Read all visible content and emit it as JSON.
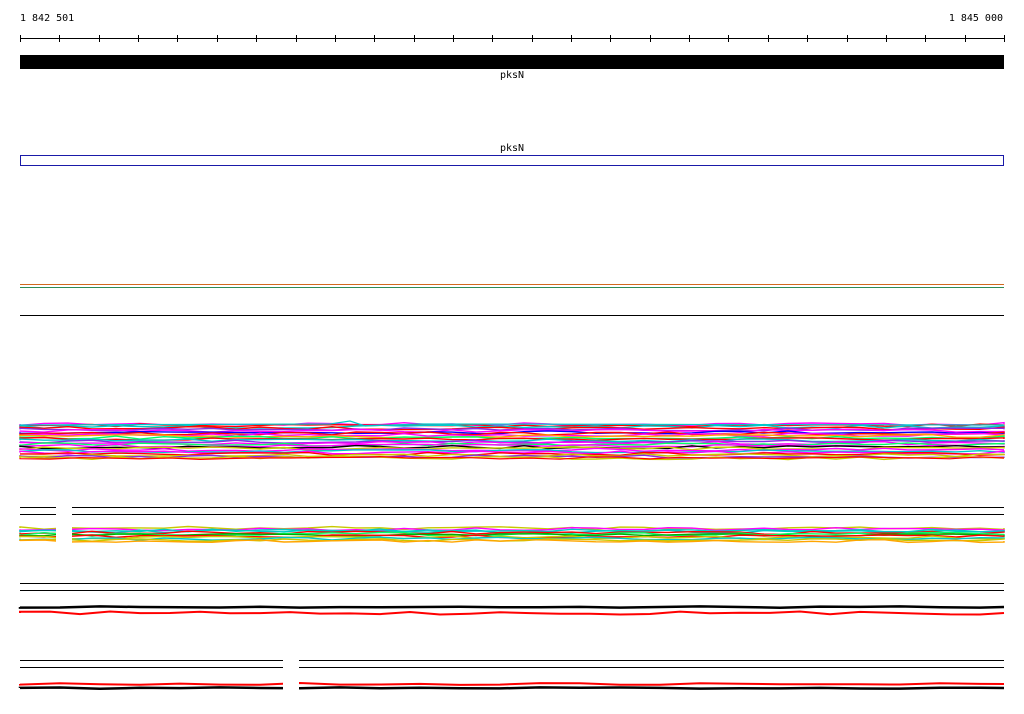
{
  "ruler": {
    "start_label": "1 842 501",
    "end_label": "1 845 000"
  },
  "genes": [
    {
      "label": "pksN",
      "track": "gene-bar",
      "color": "#000000"
    },
    {
      "label": "pksN",
      "track": "gene-outline",
      "color": "#1a1aa8"
    }
  ],
  "colors": {
    "ruler": "#000000",
    "gene_bar": "#000000",
    "gene_outline": "#1a1aa8",
    "alignment_palette": [
      "#ff00ff",
      "#00c8c8",
      "#ff0000",
      "#00aa00",
      "#0000ff",
      "#ffa500",
      "#8a2be2",
      "#00ff66",
      "#c8c800",
      "#000000"
    ]
  }
}
